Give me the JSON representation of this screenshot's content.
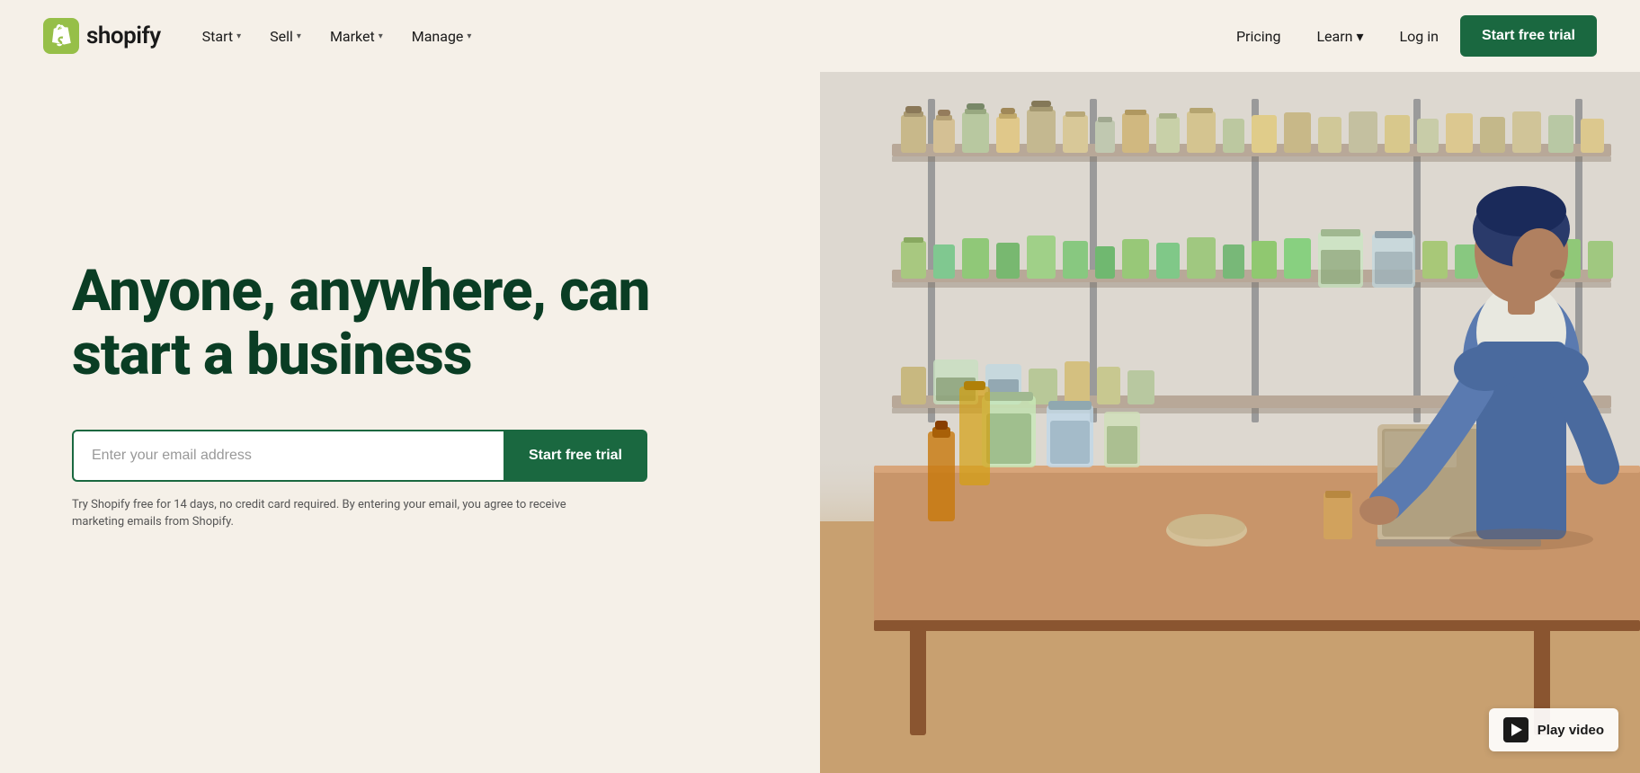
{
  "nav": {
    "logo_text": "shopify",
    "menu_items": [
      {
        "label": "Start",
        "has_dropdown": true
      },
      {
        "label": "Sell",
        "has_dropdown": true
      },
      {
        "label": "Market",
        "has_dropdown": true
      },
      {
        "label": "Manage",
        "has_dropdown": true
      }
    ],
    "right_items": [
      {
        "label": "Pricing",
        "has_dropdown": false
      },
      {
        "label": "Learn",
        "has_dropdown": true
      },
      {
        "label": "Log in",
        "has_dropdown": false
      }
    ],
    "cta_label": "Start free trial"
  },
  "hero": {
    "heading_line1": "Anyone, anywhere, can",
    "heading_line2": "start a business",
    "email_placeholder": "Enter your email address",
    "cta_label": "Start free trial",
    "disclaimer": "Try Shopify free for 14 days, no credit card required. By entering your email, you agree to receive marketing emails from Shopify."
  },
  "video": {
    "play_label": "Play video"
  },
  "colors": {
    "brand_green": "#1a6840",
    "heading_green": "#0a3d24",
    "bg_cream": "#f5f0e8"
  }
}
